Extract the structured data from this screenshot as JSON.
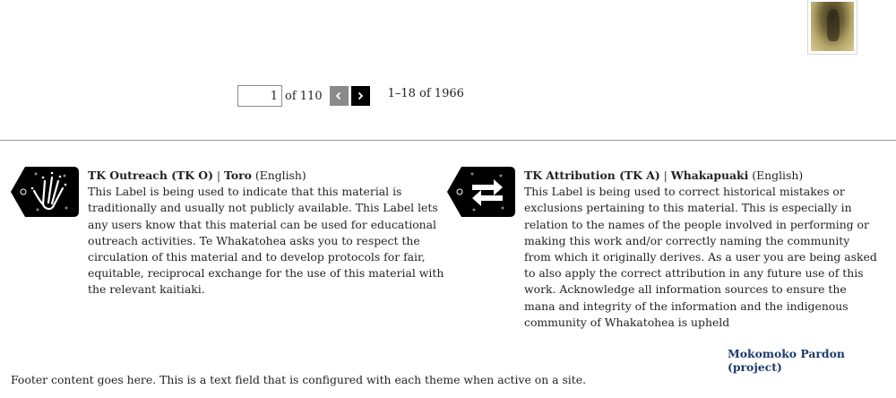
{
  "pagination": {
    "current_page": "1",
    "of_total": "of 110",
    "range": "1–18 of 1966"
  },
  "labels": [
    {
      "code": "TK Outreach (TK O)",
      "separator": " | ",
      "name": "Toro",
      "language": " (English)",
      "description": "This Label is being used to indicate that this material is traditionally and usually not publicly available. This Label lets any users know that this material can be used for educational outreach activities. Te Whakatohea asks you to respect the circulation of this material and to develop protocols for fair, equitable, reciprocal exchange for the use of this material with the relevant kaitiaki.",
      "icon": "hand-icon"
    },
    {
      "code": "TK Attribution (TK A)",
      "separator": " | ",
      "name": "Whakapuaki",
      "language": " (English)",
      "description": "This Label is being used to correct historical mistakes or exclusions pertaining to this material. This is especially in relation to the names of the people involved in performing or making this work and/or correctly naming the community from which it originally derives. As a user you are being asked to also apply the correct attribution in any future use of this work. Acknowledge all information sources to ensure the mana and integrity of the information and the indigenous community of Whakatohea is upheld",
      "icon": "exchange-arrows-icon"
    }
  ],
  "project_link": "Mokomoko Pardon (project)",
  "footer": "Footer content goes here. This is a text field that is configured with each theme when active on a site.",
  "colors": {
    "link": "#1d3a6b",
    "prev_button": "#8a8a8a",
    "next_button": "#000000"
  }
}
